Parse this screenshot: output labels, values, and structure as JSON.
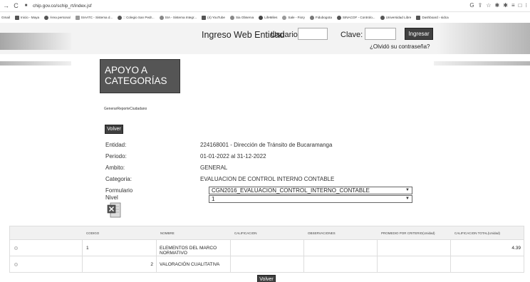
{
  "browser": {
    "url": "chip.gov.co/schip_rt/index.jsf",
    "bookmarks": [
      {
        "label": "Gmail"
      },
      {
        "label": "Inicio - Maya"
      },
      {
        "label": "Área personal"
      },
      {
        "label": "SIAATC - Sistema d..."
      },
      {
        "label": ":: Colegio San Pedr..."
      },
      {
        "label": "SIA - Sistema Integr..."
      },
      {
        "label": "(4) YouTube"
      },
      {
        "label": "Sia Observa"
      },
      {
        "label": "LifeMiles"
      },
      {
        "label": "Sale - Fiory"
      },
      {
        "label": "Fidubogota"
      },
      {
        "label": "SINACOF - Controlo..."
      },
      {
        "label": "Universidad Libre"
      },
      {
        "label": "Dashboard › sidca"
      }
    ]
  },
  "login": {
    "title": "Ingreso Web Entidad",
    "user_label": "Usuario:",
    "user_value": "",
    "password_label": "Clave:",
    "password_value": "",
    "submit_label": "Ingresar",
    "forgot_link": "¿Olvidó su contraseña?"
  },
  "page": {
    "title_line1": "APOYO A",
    "title_line2": "CATEGORÍAS",
    "subtitle": "GenerarReporteCiudadano",
    "back_button": "Volver"
  },
  "fields": {
    "entidad_label": "Entidad:",
    "entidad_value": "224168001 - Dirección de Tránsito de Bucaramanga",
    "periodo_label": "Periodo:",
    "periodo_value": "01-01-2022 al 31-12-2022",
    "ambito_label": "Ambito:",
    "ambito_value": "GENERAL",
    "categoria_label": "Categoria:",
    "categoria_value": "EVALUACION DE CONTROL INTERNO CONTABLE",
    "formulario_label": "Formulario",
    "formulario_value": "CGN2016_EVALUACION_CONTROL_INTERNO_CONTABLE",
    "nivel_label": "Nivel",
    "nivel_value": "1"
  },
  "table": {
    "headers": {
      "codigo": "CODIGO",
      "nombre": "NOMBRE",
      "calificacion": "CALIFICACION",
      "observaciones": "OBSERVACIONES",
      "promedio": "PROMEDIO POR CRITERIO(Unidad)",
      "total": "CALIFICACION TOTAL(Unidad)"
    },
    "rows": [
      {
        "codigo": "1",
        "nombre": "ELEMENTOS DEL MARCO NORMATIVO",
        "calificacion": "",
        "observaciones": "",
        "promedio": "",
        "total": "4.39"
      },
      {
        "codigo": "2",
        "nombre": "VALORACIÓN CUALITATIVA",
        "calificacion": "",
        "observaciones": "",
        "promedio": "",
        "total": ""
      }
    ]
  },
  "footer": {
    "back_button": "Volver"
  }
}
